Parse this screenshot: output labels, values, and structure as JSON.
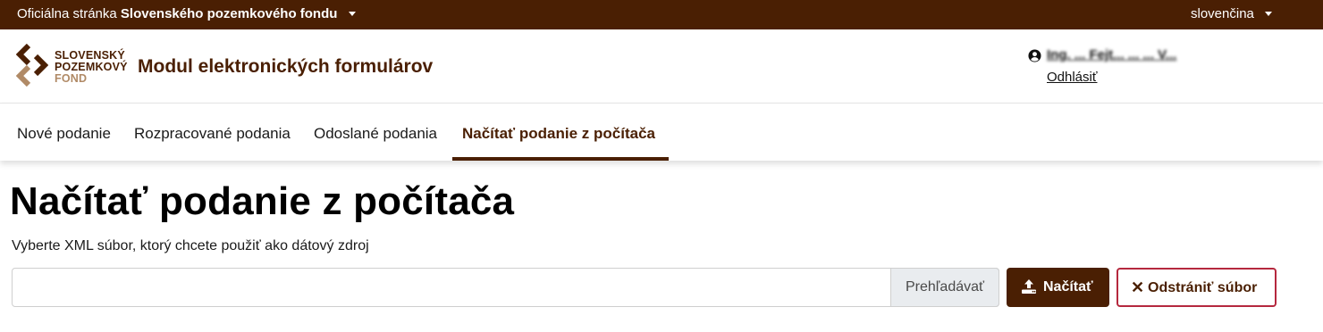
{
  "topbar": {
    "official_prefix": "Oficiálna stránka",
    "official_name": "Slovenského pozemkového fondu",
    "language": "slovenčina"
  },
  "logo": {
    "line1": "SLOVENSKÝ",
    "line2": "POZEMKOVÝ",
    "line3": "FOND"
  },
  "header": {
    "app_title": "Modul elektronických formulárov",
    "user_name": "Ing. ... Fejt... ... ... V...",
    "logout": "Odhlásiť"
  },
  "nav": {
    "tabs": [
      {
        "label": "Nové podanie"
      },
      {
        "label": "Rozpracované podania"
      },
      {
        "label": "Odoslané podania"
      },
      {
        "label": "Načítať podanie z počítača"
      }
    ]
  },
  "main": {
    "title": "Načítať podanie z počítača",
    "hint": "Vyberte XML súbor, ktorý chcete použiť ako dátový zdroj",
    "browse_label": "Prehľadávať",
    "load_label": "Načítať",
    "remove_label": "Odstrániť súbor"
  },
  "colors": {
    "brand": "#4a1f03",
    "accent_light": "#b08a66",
    "danger_border": "#b5283e"
  },
  "icons": {
    "user": "user-circle-icon",
    "upload": "upload-icon",
    "remove": "close-icon",
    "dropdown": "caret-down-icon"
  }
}
